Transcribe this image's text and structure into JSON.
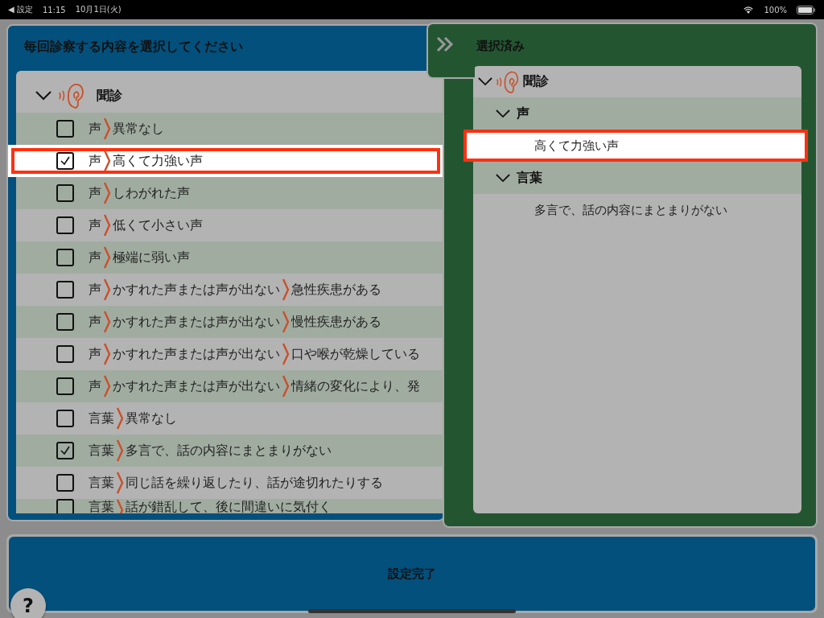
{
  "status_bar": {
    "back": "◀ 設定",
    "time": "11:15",
    "date": "10月1日(火)",
    "battery": "100%"
  },
  "left_panel": {
    "title": "毎回診察する内容を選択してください",
    "group": {
      "label": "聞診",
      "expanded": true,
      "rows": [
        {
          "checked": false,
          "highlighted": false,
          "path": [
            "声",
            "異常なし"
          ]
        },
        {
          "checked": true,
          "highlighted": true,
          "path": [
            "声",
            "高くて力強い声"
          ]
        },
        {
          "checked": false,
          "highlighted": false,
          "path": [
            "声",
            "しわがれた声"
          ]
        },
        {
          "checked": false,
          "highlighted": false,
          "path": [
            "声",
            "低くて小さい声"
          ]
        },
        {
          "checked": false,
          "highlighted": false,
          "path": [
            "声",
            "極端に弱い声"
          ]
        },
        {
          "checked": false,
          "highlighted": false,
          "path": [
            "声",
            "かすれた声または声が出ない",
            "急性疾患がある"
          ]
        },
        {
          "checked": false,
          "highlighted": false,
          "path": [
            "声",
            "かすれた声または声が出ない",
            "慢性疾患がある"
          ]
        },
        {
          "checked": false,
          "highlighted": false,
          "path": [
            "声",
            "かすれた声または声が出ない",
            "口や喉が乾燥している"
          ]
        },
        {
          "checked": false,
          "highlighted": false,
          "path": [
            "声",
            "かすれた声または声が出ない",
            "情緒の変化により、発"
          ]
        },
        {
          "checked": false,
          "highlighted": false,
          "path": [
            "言葉",
            "異常なし"
          ]
        },
        {
          "checked": true,
          "highlighted": false,
          "path": [
            "言葉",
            "多言で、話の内容にまとまりがない"
          ]
        },
        {
          "checked": false,
          "highlighted": false,
          "path": [
            "言葉",
            "同じ話を繰り返したり、話が途切れたりする"
          ]
        },
        {
          "checked": false,
          "highlighted": false,
          "path": [
            "言葉",
            "話が錯乱して、後に間違いに気付く"
          ]
        }
      ]
    }
  },
  "right_panel": {
    "title": "選択済み",
    "group": {
      "label": "聞診",
      "expanded": true,
      "children": [
        {
          "label": "声",
          "expanded": true,
          "items": [
            {
              "text": "高くて力強い声",
              "highlighted": true
            }
          ]
        },
        {
          "label": "言葉",
          "expanded": true,
          "items": [
            {
              "text": "多言で、話の内容にまとまりがない",
              "highlighted": false
            }
          ]
        }
      ]
    }
  },
  "done_button": "設定完了",
  "help_button": "?"
}
